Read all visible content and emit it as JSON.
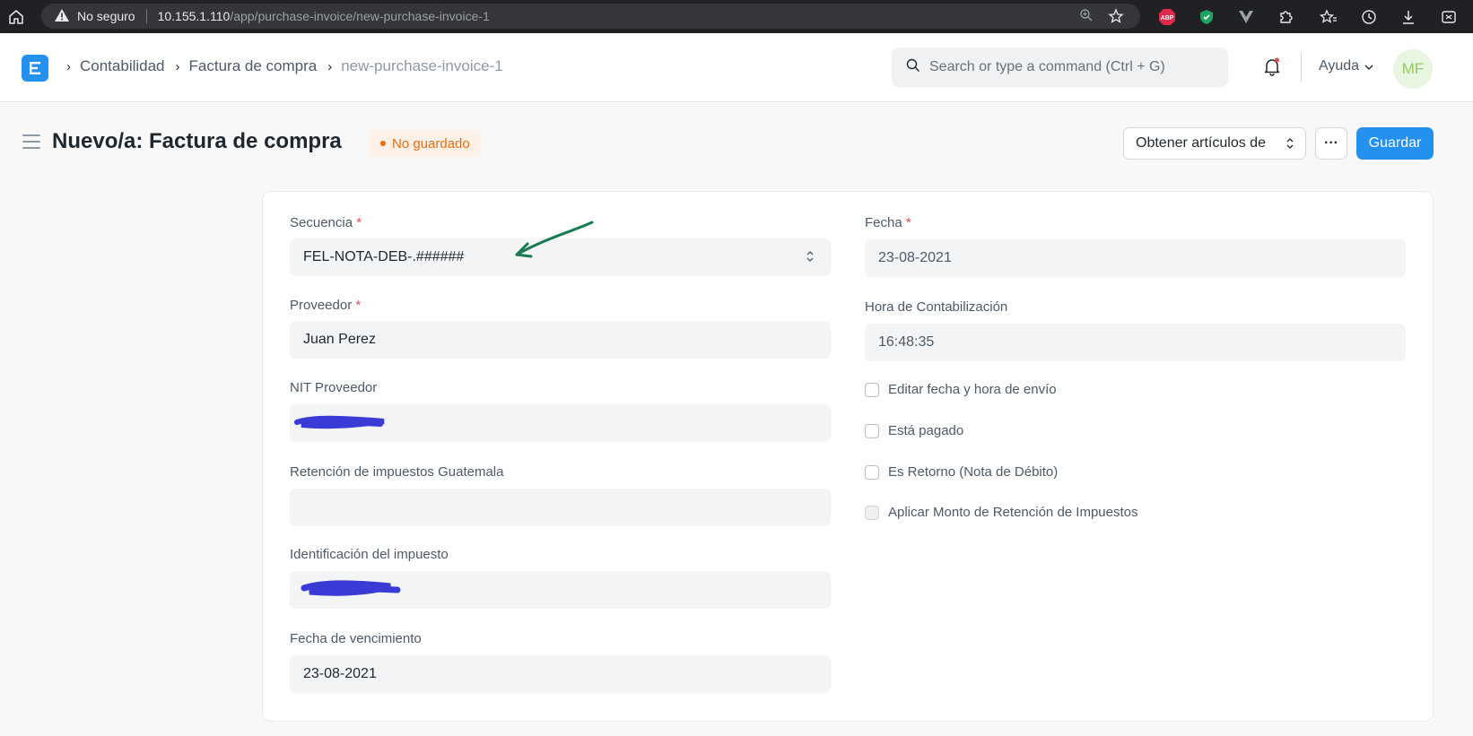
{
  "browser": {
    "security_label": "No seguro",
    "url_host": "10.155.1.110",
    "url_path": "/app/purchase-invoice/new-purchase-invoice-1",
    "extensions": [
      "abp-icon",
      "shield-icon",
      "vue-icon",
      "puzzle-icon",
      "favorites-icon",
      "history-icon",
      "download-icon",
      "screenshot-icon"
    ],
    "abp_label": "ABP"
  },
  "navbar": {
    "breadcrumbs": [
      "Contabilidad",
      "Factura de compra",
      "new-purchase-invoice-1"
    ],
    "search_placeholder": "Search or type a command (Ctrl + G)",
    "help_label": "Ayuda",
    "avatar_initials": "MF",
    "brand_color": "#2490ef"
  },
  "page": {
    "title": "Nuevo/a: Factura de compra",
    "status": "No guardado",
    "get_items_label": "Obtener artículos de",
    "more_label": "···",
    "save_label": "Guardar"
  },
  "form": {
    "left": {
      "series_label": "Secuencia",
      "series_value": "FEL-NOTA-DEB-.######",
      "supplier_label": "Proveedor",
      "supplier_value": "Juan Perez",
      "supplier_nit_label": "NIT Proveedor",
      "withholding_label": "Retención de impuestos Guatemala",
      "tax_id_label": "Identificación del impuesto",
      "due_date_label": "Fecha de vencimiento",
      "due_date_value": "23-08-2021"
    },
    "right": {
      "date_label": "Fecha",
      "date_value": "23-08-2021",
      "posting_time_label": "Hora de Contabilización",
      "posting_time_value": "16:48:35",
      "check_edit_posting": "Editar fecha y hora de envío",
      "check_is_paid": "Está pagado",
      "check_is_return": "Es Retorno (Nota de Débito)",
      "check_apply_tds": "Aplicar Monto de Retención de Impuestos"
    },
    "required_mark": "*"
  }
}
